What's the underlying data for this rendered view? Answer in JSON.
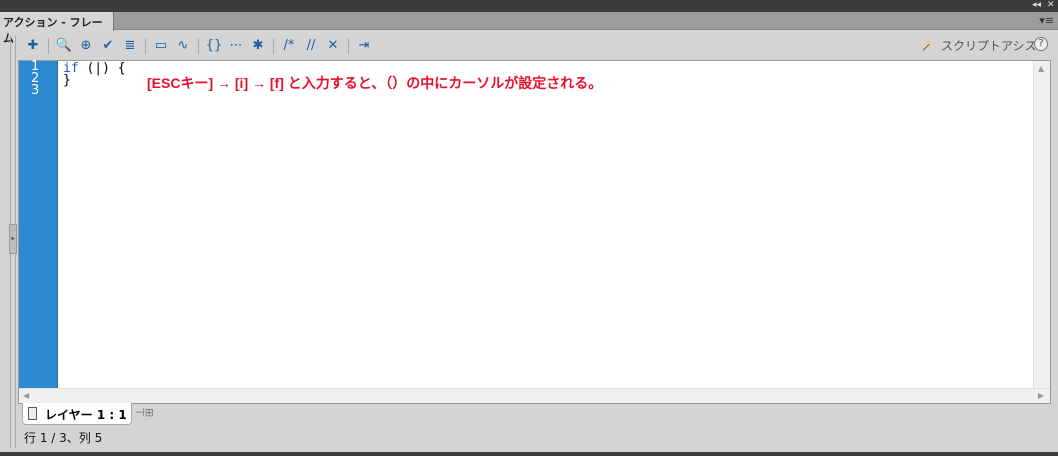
{
  "panel": {
    "tab_title": "アクション - フレーム"
  },
  "toolbar": {
    "buttons": [
      {
        "name": "add-action",
        "glyph": "✚"
      },
      {
        "name": "find",
        "glyph": "🔍"
      },
      {
        "name": "target-path",
        "glyph": "⊕"
      },
      {
        "name": "check-syntax",
        "glyph": "✔"
      },
      {
        "name": "auto-format",
        "glyph": "≣"
      },
      {
        "name": "code-hint",
        "glyph": "▭"
      },
      {
        "name": "debug-options",
        "glyph": "∿"
      },
      {
        "name": "collapse-between-braces",
        "glyph": "{}"
      },
      {
        "name": "collapse-selection",
        "glyph": "⋯"
      },
      {
        "name": "expand-all",
        "glyph": "✱"
      },
      {
        "name": "apply-block-comment",
        "glyph": "/*"
      },
      {
        "name": "apply-line-comment",
        "glyph": "//"
      },
      {
        "name": "remove-comment",
        "glyph": "✕"
      },
      {
        "name": "show-hide-toolbox",
        "glyph": "⇥"
      }
    ],
    "script_assist": "スクリプトアシスト",
    "help": "?"
  },
  "editor": {
    "line_numbers": [
      "1",
      "2",
      "3"
    ],
    "lines": [
      {
        "kw": "if",
        "rest": " (|) {"
      },
      {
        "kw": "",
        "rest": "}"
      },
      {
        "kw": "",
        "rest": ""
      }
    ],
    "annotation": "[ESCキー] → [i] → [f] と入力すると、（）の中にカーソルが設定される。"
  },
  "layer_tab": {
    "label": "レイヤー 1 : 1"
  },
  "status": {
    "text": "行 1 / 3、列 5"
  },
  "colors": {
    "gutter": "#2b8ad0",
    "annotation": "#e8102a",
    "keyword": "#1a4fd6"
  }
}
